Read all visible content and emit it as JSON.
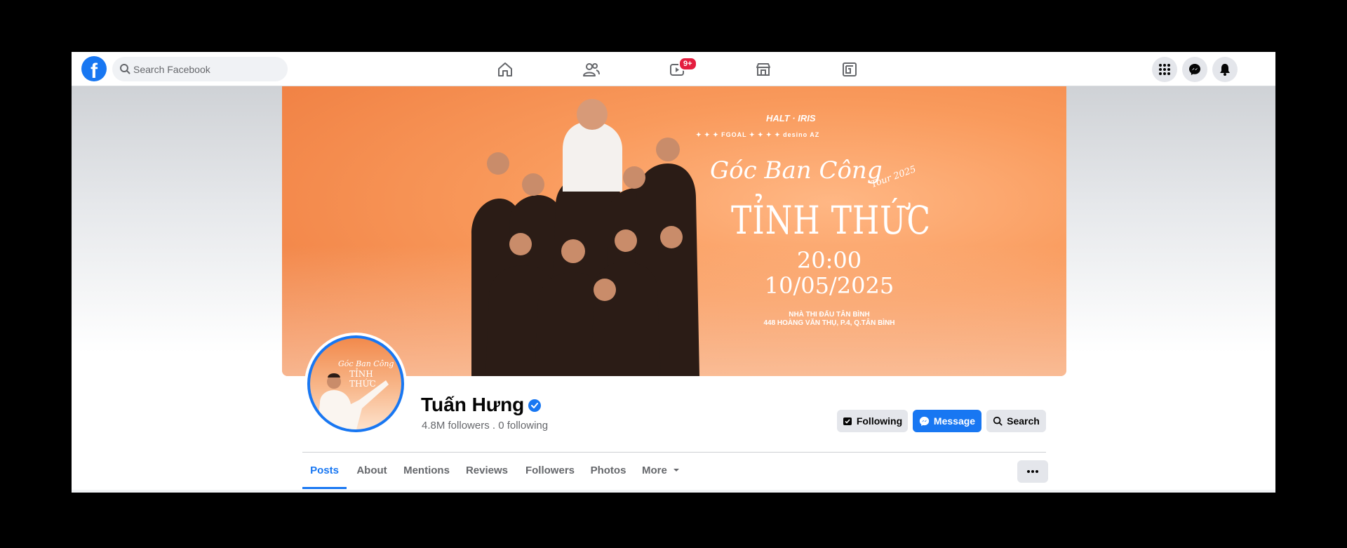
{
  "topbar": {
    "logo": "f",
    "search_placeholder": "Search Facebook",
    "nav": [
      {
        "icon": "home-icon"
      },
      {
        "icon": "friends-icon"
      },
      {
        "icon": "watch-icon",
        "badge": "9+"
      },
      {
        "icon": "marketplace-icon"
      },
      {
        "icon": "gaming-icon"
      }
    ],
    "right": [
      {
        "icon": "menu-grid-icon"
      },
      {
        "icon": "messenger-icon"
      },
      {
        "icon": "notifications-bell-icon"
      }
    ]
  },
  "cover": {
    "logos_line": "HALT · IRIS",
    "logos_row": "✦ ✦ ✦ FGOAL ✦ ✦ ✦ ✦ desino AZ",
    "title": "Góc Ban Công",
    "tour": "Tour 2025",
    "subtitle": "TỈNH THỨC",
    "time": "20:00",
    "date": "10/05/2025",
    "venue_name": "NHÀ THI ĐẤU TÂN BÌNH",
    "venue_address": "448 HOÀNG VĂN THỤ, P.4, Q.TÂN BÌNH"
  },
  "avatar": {
    "title": "Góc Ban Công",
    "subtitle": "TỈNH THỨC"
  },
  "profile": {
    "name": "Tuấn Hưng",
    "stats": "4.8M followers . 0 following"
  },
  "actions": {
    "following": "Following",
    "message": "Message",
    "search": "Search"
  },
  "tabs": [
    {
      "label": "Posts",
      "active": true
    },
    {
      "label": "About"
    },
    {
      "label": "Mentions"
    },
    {
      "label": "Reviews"
    },
    {
      "label": "Followers"
    },
    {
      "label": "Photos"
    },
    {
      "label": "More"
    }
  ],
  "colors": {
    "brand": "#1877f2",
    "badge": "#e41e3f",
    "button_gray": "#e4e6eb"
  }
}
